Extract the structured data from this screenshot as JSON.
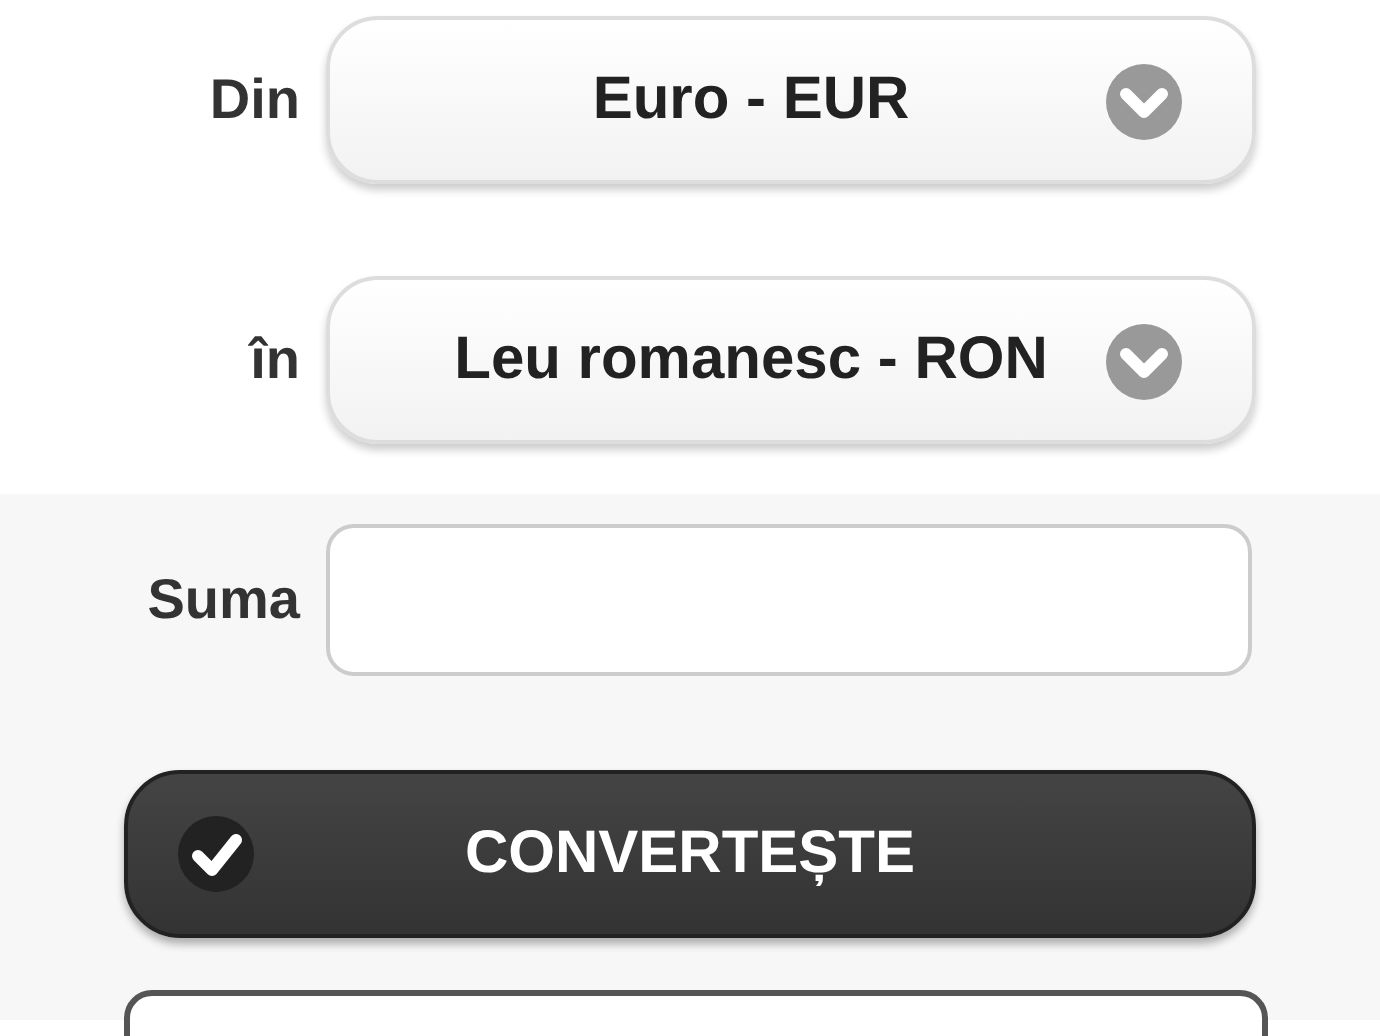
{
  "from": {
    "label": "Din",
    "value": "Euro - EUR"
  },
  "to": {
    "label": "în",
    "value": "Leu romanesc - RON"
  },
  "amount": {
    "label": "Suma"
  },
  "convert_button": {
    "label": "CONVERTEȘTE"
  }
}
